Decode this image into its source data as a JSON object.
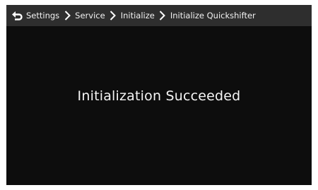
{
  "breadcrumb": {
    "back_icon": "back-arrow-icon",
    "separator_icon": "chevron-right-icon",
    "items": [
      {
        "label": "Settings"
      },
      {
        "label": "Service"
      },
      {
        "label": "Initialize"
      },
      {
        "label": "Initialize Quickshifter"
      }
    ]
  },
  "main": {
    "message": "Initialization Succeeded"
  },
  "colors": {
    "screen_background": "#0d0d0d",
    "header_background": "#2e2e2e",
    "text": "#ffffff"
  }
}
